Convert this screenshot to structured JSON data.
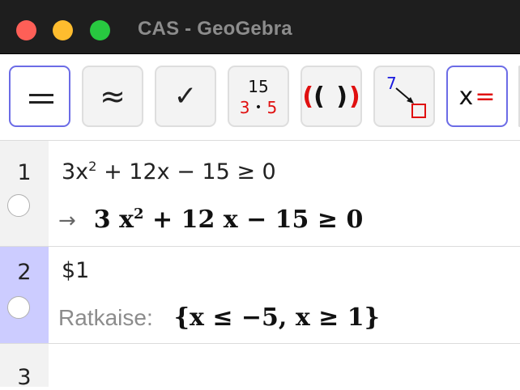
{
  "window": {
    "title": "CAS - GeoGebra"
  },
  "toolbar": {
    "evaluate_icon": "equals-icon",
    "numeric_symbol": "≈",
    "check_symbol": "✓",
    "factor_top": "15",
    "factor_a": "3",
    "factor_dot": "•",
    "factor_b": "5",
    "expand_outer": "(",
    "expand_inner": "( )",
    "expand_close": ")",
    "substitute_num": "7",
    "solve_x": "x",
    "solve_eq": "="
  },
  "rows": [
    {
      "num": "1",
      "input": {
        "base": "3x",
        "exp": "2",
        "rest": " + 12x − 15 ≥ 0"
      },
      "output": {
        "arrow": "→",
        "base": "3 x",
        "exp": "2",
        "rest": " + 12 x − 15 ≥ 0"
      }
    },
    {
      "num": "2",
      "input": "$1",
      "output": {
        "label": "Ratkaise:",
        "value": "{x ≤ −5, x ≥ 1}"
      }
    },
    {
      "num": "3"
    }
  ],
  "colors": {
    "active_border": "#6c6ce6",
    "selected_row": "#ccccff",
    "accent_red": "#e01010",
    "accent_blue": "#1a1adf"
  }
}
